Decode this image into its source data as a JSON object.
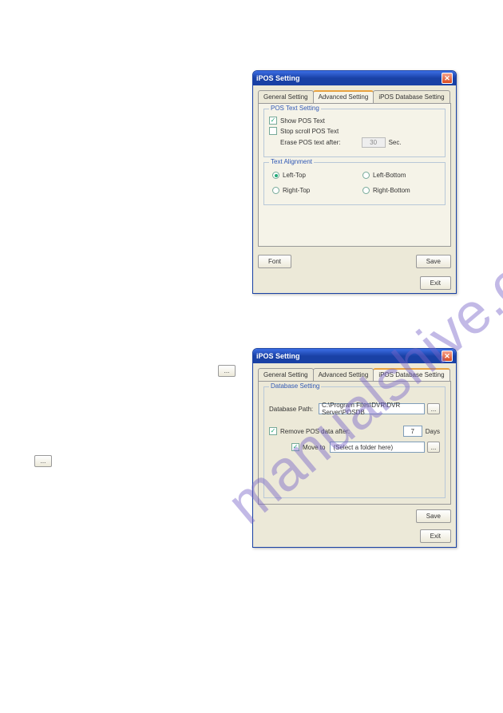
{
  "watermark": "manualshive.com",
  "dialog1": {
    "title": "iPOS Setting",
    "tabs": {
      "general": "General Setting",
      "advanced": "Advanced Setting",
      "db": "iPOS Database Setting"
    },
    "pos_text": {
      "legend": "POS Text Setting",
      "show": "Show POS Text",
      "stop_scroll": "Stop scroll POS Text",
      "erase_label": "Erase POS text after:",
      "erase_value": "30",
      "erase_unit": "Sec."
    },
    "align": {
      "legend": "Text Alignment",
      "lt": "Left-Top",
      "lb": "Left-Bottom",
      "rt": "Right-Top",
      "rb": "Right-Bottom"
    },
    "buttons": {
      "font": "Font",
      "save": "Save",
      "exit": "Exit"
    }
  },
  "dialog2": {
    "title": "iPOS Setting",
    "tabs": {
      "general": "General Setting",
      "advanced": "Advanced Setting",
      "db": "iPOS Database Setting"
    },
    "db": {
      "legend": "Database Setting",
      "path_label": "Database Path:",
      "path_value": "C:\\Program Files\\DVR\\DVR Server\\POSDB",
      "remove_label": "Remove POS data after:",
      "remove_value": "7",
      "remove_unit": "Days",
      "move_to": "Move to",
      "move_to_value": "(Select a folder here)"
    },
    "buttons": {
      "save": "Save",
      "exit": "Exit"
    },
    "browse": "..."
  },
  "floating": {
    "ellipsis": "..."
  }
}
